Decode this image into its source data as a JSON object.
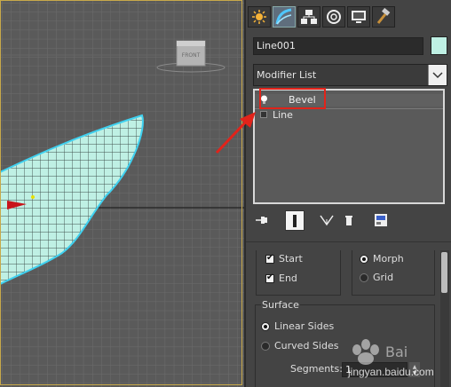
{
  "viewport": {
    "name": "Front viewport",
    "viewcube_label": "FRONT"
  },
  "panel": {
    "tabs": [
      {
        "name": "create-tab",
        "icon": "sun-star-icon"
      },
      {
        "name": "modify-tab",
        "icon": "modify-curve-icon",
        "active": true
      },
      {
        "name": "hierarchy-tab",
        "icon": "hierarchy-icon"
      },
      {
        "name": "motion-tab",
        "icon": "motion-icon"
      },
      {
        "name": "display-tab",
        "icon": "display-monitor-icon"
      },
      {
        "name": "utilities-tab",
        "icon": "hammer-icon"
      }
    ],
    "object_name": "Line001",
    "object_color": "#bff0e4",
    "modifier_list": {
      "label": "Modifier List"
    },
    "stack": [
      {
        "label": "Bevel",
        "icon": "lightbulb-icon",
        "selected": true
      },
      {
        "label": "Line",
        "icon": "plus-expand-icon"
      }
    ],
    "stack_tools": [
      "pin-stack-icon",
      "show-end-result-icon",
      "make-unique-icon",
      "remove-modifier-icon",
      "configure-sets-icon"
    ]
  },
  "rollout": {
    "capping": {
      "start": {
        "label": "Start",
        "checked": true
      },
      "end": {
        "label": "End",
        "checked": true
      }
    },
    "cap_type": {
      "morph": {
        "label": "Morph",
        "selected": true
      },
      "grid": {
        "label": "Grid",
        "selected": false
      }
    },
    "surface": {
      "title": "Surface",
      "linear_sides": {
        "label": "Linear Sides",
        "selected": true
      },
      "curved_sides": {
        "label": "Curved Sides",
        "selected": false
      },
      "segments_label": "Segments:",
      "segments_value": "1"
    }
  },
  "annotation": {
    "highlight_color": "#e2231a",
    "watermark_text": "jingyan.baidu.com"
  }
}
